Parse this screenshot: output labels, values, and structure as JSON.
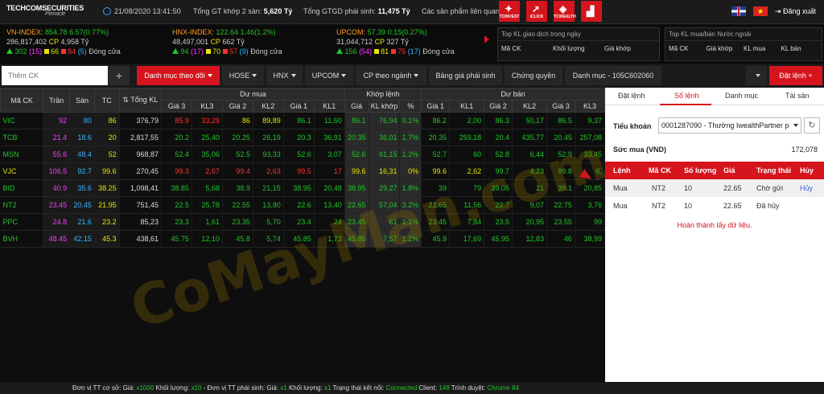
{
  "header": {
    "logo_text": "TECHCOMSECURITIES",
    "logo_sub": "Pinnacle",
    "datetime": "21/08/2020 13:41:50",
    "tong_gt_label": "Tổng GT khớp 2 sàn:",
    "tong_gt_value": "5,620 Tỷ",
    "tong_gtgd_label": "Tổng GTGD phái sinh:",
    "tong_gtgd_value": "11,475 Tỷ",
    "related_products": "Các sản phẩm liên quan",
    "tiles": [
      "TCINVEST",
      "iCLICK",
      "TCWEALTH",
      "CHART"
    ],
    "logout": "Đăng xuất"
  },
  "indices": [
    {
      "name": "VN-INDEX:",
      "value": "854.78",
      "change": "6.57(0.77%)",
      "vol": "286,817,402",
      "cp": "CP",
      "gt": "4,958 Tỷ",
      "up": "302",
      "ce": "(15)",
      "ref": "66",
      "dn": "84",
      "fl": "(5)",
      "status": "Đóng cửa"
    },
    {
      "name": "HNX-INDEX:",
      "value": "122.64",
      "change": "1.46(1.2%)",
      "vol": "48,497,001",
      "cp": "CP",
      "gt": "662 Tỷ",
      "up": "94",
      "ce": "(17)",
      "ref": "70",
      "dn": "57",
      "fl": "(9)",
      "status": "Đóng cửa"
    },
    {
      "name": "UPCOM:",
      "value": "57.39",
      "change": "0.15(0.27%)",
      "vol": "31,044,712",
      "cp": "CP",
      "gt": "327 Tỷ",
      "up": "156",
      "ce": "(54)",
      "ref": "81",
      "dn": "75",
      "fl": "(17)",
      "status": "Đóng cửa"
    }
  ],
  "top_kl": {
    "title": "Top KL giao dịch trong ngày",
    "cols": [
      "Mã CK",
      "Khối lượng",
      "Giá khớp"
    ]
  },
  "top_foreign": {
    "title": "Top KL mua/bán Nước ngoài",
    "cols": [
      "Mã CK",
      "Giá khớp",
      "KL mua",
      "KL bán"
    ]
  },
  "tabbar": {
    "search_placeholder": "Thêm CK",
    "tabs": [
      "Danh mục theo dõi",
      "HOSE",
      "HNX",
      "UPCOM",
      "CP theo ngành",
      "Bảng giá phái sinh",
      "Chứng quyền",
      "Danh mục - 105C602060"
    ],
    "order_button": "Đặt lệnh"
  },
  "board": {
    "headers_top": [
      "Mã CK",
      "Trần",
      "Sàn",
      "TC",
      "Tổng KL",
      "Dư mua",
      "Khớp lệnh",
      "Dư bán"
    ],
    "headers_sub": [
      "Giá 3",
      "KL3",
      "Giá 2",
      "KL2",
      "Giá 1",
      "KL1",
      "Giá",
      "KL khớp",
      "%",
      "Giá 1",
      "KL1",
      "Giá 2",
      "KL2",
      "Giá 3",
      "KL3"
    ],
    "rows": [
      [
        "VIC",
        "92",
        "80",
        "86",
        "376,79",
        "85.9",
        "33,29",
        "86",
        "89,89",
        "86.1",
        "11,60",
        "86.1",
        "76,94",
        "0.1%",
        "86.2",
        "2,00",
        "86.3",
        "50,17",
        "86.5",
        "9,37"
      ],
      [
        "TCB",
        "21.4",
        "18.6",
        "20",
        "2,817,55",
        "20.2",
        "25,40",
        "20.25",
        "26,19",
        "20.3",
        "36,91",
        "20.35",
        "36,01",
        "1.7%",
        "20.35",
        "259,18",
        "20.4",
        "435,77",
        "20.45",
        "257,08"
      ],
      [
        "MSN",
        "55.6",
        "48.4",
        "52",
        "968,87",
        "52.4",
        "35,06",
        "52.5",
        "93,33",
        "52.6",
        "3,07",
        "52.6",
        "61,15",
        "1.2%",
        "52.7",
        "60",
        "52.8",
        "6,44",
        "52.9",
        "33,45"
      ],
      [
        "VJC",
        "106.5",
        "92.7",
        "99.6",
        "270,45",
        "99.3",
        "2,67",
        "99.4",
        "2,63",
        "99.5",
        "17",
        "99.6",
        "16,31",
        "0%",
        "99.6",
        "2,62",
        "99.7",
        "4,23",
        "99.8",
        "6,"
      ],
      [
        "BID",
        "40.9",
        "35.6",
        "38.25",
        "1,098,41",
        "38.85",
        "5,68",
        "38.9",
        "21,15",
        "38.95",
        "20,48",
        "38.95",
        "29,27",
        "1.8%",
        "39",
        "79",
        "39.05",
        "21",
        "39.1",
        "20,85"
      ],
      [
        "NT2",
        "23.45",
        "20.45",
        "21.95",
        "751,45",
        "22.5",
        "25,78",
        "22.55",
        "13,80",
        "22.6",
        "13,40",
        "22.65",
        "57,04",
        "3.2%",
        "22.65",
        "11,56",
        "22.7",
        "9,07",
        "22.75",
        "3,76"
      ],
      [
        "PPC",
        "24.8",
        "21.6",
        "23.2",
        "85,23",
        "23.3",
        "1,61",
        "23.35",
        "5,70",
        "23.4",
        "24",
        "23.45",
        "61",
        "1.1%",
        "23.45",
        "7,84",
        "23.5",
        "20,95",
        "23.55",
        "99"
      ],
      [
        "BVH",
        "48.45",
        "42.15",
        "45.3",
        "438,61",
        "45.75",
        "12,10",
        "45.8",
        "5,74",
        "45.85",
        "1,73",
        "45.85",
        "7,57",
        "1.2%",
        "45.9",
        "17,69",
        "45.95",
        "12,83",
        "46",
        "38,99"
      ]
    ]
  },
  "panel": {
    "tabs": [
      "Đặt lệnh",
      "Sổ lệnh",
      "Danh mục",
      "Tài sản"
    ],
    "account_label": "Tiểu khoản",
    "account_value": "0001287090 - Thường IwealthPartner p",
    "power_label": "Sức mua (VND)",
    "power_value": "172,078",
    "order_headers": [
      "Lệnh",
      "Mã CK",
      "Số lượng",
      "Giá",
      "Trạng thái",
      "Hủy"
    ],
    "orders": [
      {
        "side": "Mua",
        "sym": "NT2",
        "qty": "10",
        "price": "22.65",
        "status": "Chờ gửi",
        "cancel": "Hủy"
      },
      {
        "side": "Mua",
        "sym": "NT2",
        "qty": "10",
        "price": "22.65",
        "status": "Đã hủy",
        "cancel": ""
      }
    ],
    "done_msg": "Hoàn thành lấy dữ liệu."
  },
  "footer": {
    "p1": "Đơn vị TT cơ sở: Giá:",
    "v1": "x1000",
    "p2": "Khối lượng:",
    "v2": "x10",
    "p3": "- Đơn vị TT phái sinh: Giá:",
    "v3": "x1",
    "p4": "Khối lượng:",
    "v4": "x1",
    "p5": "Trạng thái kết nối:",
    "v5": "Connected",
    "p6": "Client:",
    "v6": "148",
    "p7": "Trình duyệt:",
    "v7": "Chrome 84"
  },
  "watermark": "CoMayMan.com",
  "colors": {
    "accent": "#d5141d",
    "up": "#22c42a",
    "down": "#ff3131",
    "ref": "#e8e500",
    "ceiling": "#ff36ff",
    "floor": "#3ab6ff"
  }
}
